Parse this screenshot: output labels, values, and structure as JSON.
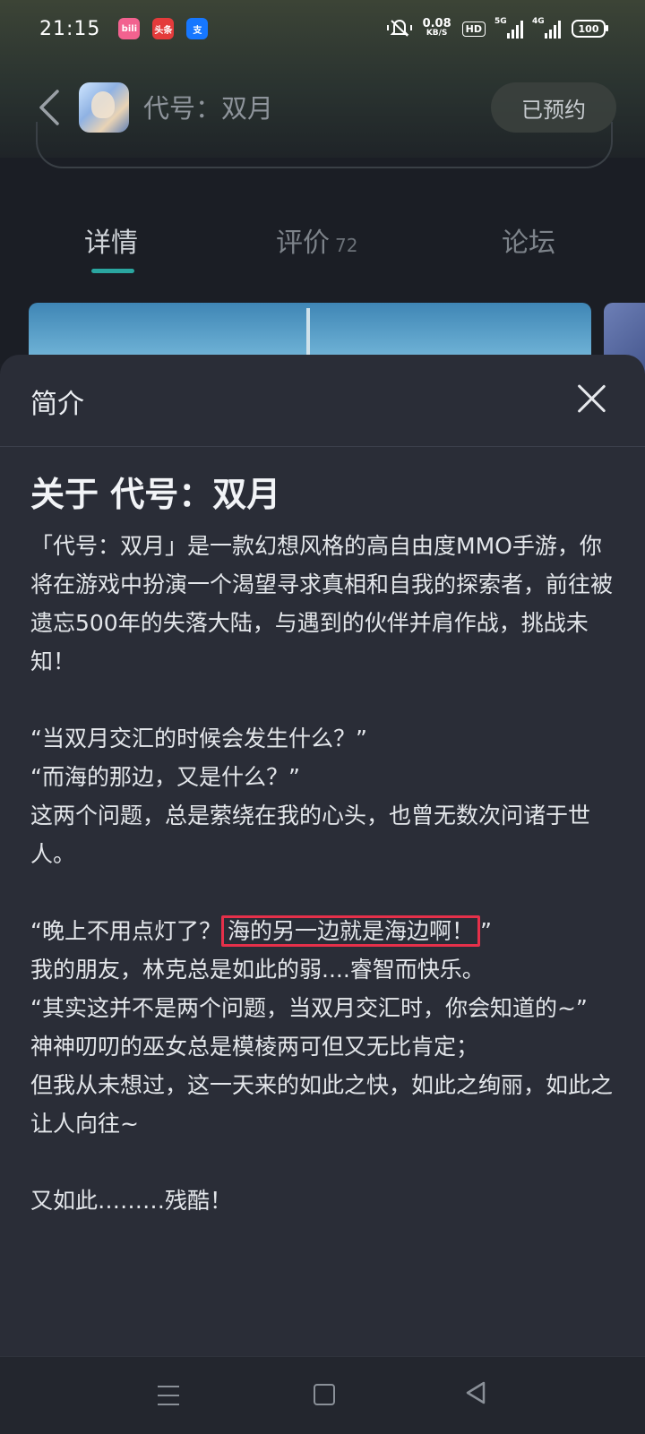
{
  "status_bar": {
    "time": "21:15",
    "apps": [
      {
        "label": "bili",
        "color": "#f2628f"
      },
      {
        "label": "头条",
        "color": "#e43b3b"
      },
      {
        "label": "支",
        "color": "#1677ff"
      }
    ],
    "net_speed_value": "0.08",
    "net_speed_unit": "KB/S",
    "hd_label": "HD",
    "signal_1_label": "5G",
    "signal_2_label": "4G",
    "battery": "100"
  },
  "header": {
    "back_icon": "chevron-left-icon",
    "game_title": "代号：双月",
    "reserve_button": "已预约"
  },
  "tabs": [
    {
      "label": "详情",
      "active": true
    },
    {
      "label": "评价",
      "count": "72"
    },
    {
      "label": "论坛"
    }
  ],
  "sheet": {
    "title": "简介",
    "heading": "关于 代号：双月",
    "p1": "「代号：双月」是一款幻想风格的高自由度MMO手游，你将在游戏中扮演一个渴望寻求真相和自我的探索者，前往被遗忘500年的失落大陆，与遇到的伙伴并肩作战，挑战未知！",
    "p2_line1": "“当双月交汇的时候会发生什么？”",
    "p2_line2": "“而海的那边，又是什么？”",
    "p2_line3": "这两个问题，总是萦绕在我的心头，也曾无数次问诸于世人。",
    "p3_prefix": "“晚上不用点灯了？",
    "p3_highlight": "海的另一边就是海边啊！",
    "p3_suffix": "”",
    "p4_line1": "我的朋友，林克总是如此的弱....睿智而快乐。",
    "p4_line2": "“其实这并不是两个问题，当双月交汇时，你会知道的~”",
    "p4_line3": "神神叨叨的巫女总是模棱两可但又无比肯定；",
    "p4_line4": "但我从未想过，这一天来的如此之快，如此之绚丽，如此之让人向往~",
    "p5": "又如此………残酷！"
  },
  "colors": {
    "highlight_border": "#e6304a",
    "tab_indicator": "#2aa6a0",
    "sheet_bg": "#2a2d37"
  }
}
